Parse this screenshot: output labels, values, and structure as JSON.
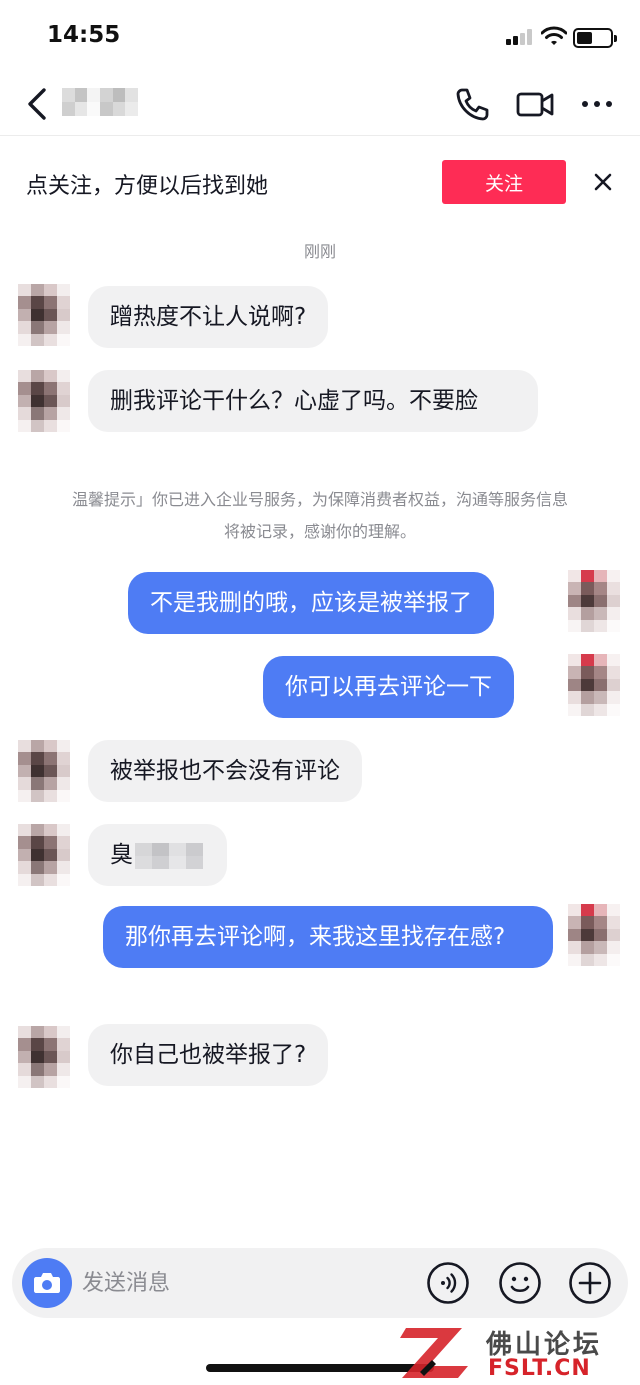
{
  "status_bar": {
    "time": "14:55"
  },
  "follow_banner": {
    "text": "点关注，方便以后找到她",
    "button_label": "关注"
  },
  "chat": {
    "time_divider": "刚刚",
    "messages": [
      {
        "side": "in",
        "text": "蹭热度不让人说啊?"
      },
      {
        "side": "in",
        "text": "删我评论干什么？心虚了吗。不要脸"
      },
      {
        "side": "out",
        "text": "不是我删的哦，应该是被举报了"
      },
      {
        "side": "out",
        "text": "你可以再去评论一下"
      },
      {
        "side": "in",
        "text": "被举报也不会没有评论"
      },
      {
        "side": "in",
        "text": "臭"
      },
      {
        "side": "out",
        "text": "那你再去评论啊，来我这里找存在感?"
      },
      {
        "side": "in",
        "text": "你自己也被举报了?"
      }
    ],
    "system_notice": "温馨提示」你已进入企业号服务，为保障消费者权益，沟通等服务信息将被记录，感谢你的理解。"
  },
  "input_bar": {
    "placeholder": "发送消息"
  },
  "icons": {
    "nav": [
      "back-icon",
      "phone-icon",
      "video-camera-icon",
      "more-icon"
    ],
    "input": [
      "camera-icon",
      "voice-icon",
      "emoji-icon",
      "plus-icon"
    ]
  },
  "colors": {
    "accent_red": "#fe2c55",
    "bubble_out": "#4e7cf4",
    "bubble_in": "#f1f1f2",
    "muted_text": "#8a8b91"
  },
  "watermark": {
    "brand": "佛山论坛",
    "domain": "FSLT.CN"
  }
}
